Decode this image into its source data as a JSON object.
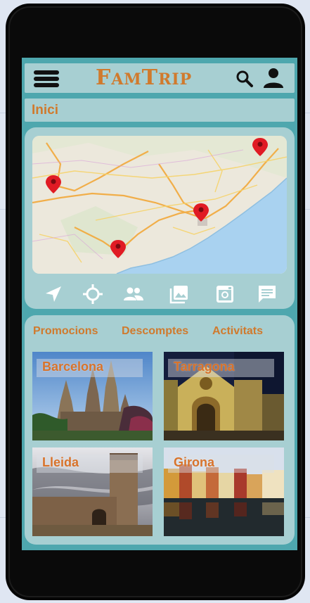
{
  "app": {
    "title_big_1": "F",
    "title_small_1": "AM",
    "title_big_2": "T",
    "title_small_2": "RIP"
  },
  "header": {
    "menu_icon": "hamburger-icon",
    "search_icon": "search-icon",
    "user_icon": "user-icon"
  },
  "breadcrumb": {
    "label": "Inici"
  },
  "toolbar": {
    "icons": [
      "navigation-arrow-icon",
      "crosshair-location-icon",
      "people-icon",
      "image-gallery-icon",
      "instagram-icon",
      "chat-message-icon"
    ]
  },
  "tabs": [
    {
      "label": "Promocions"
    },
    {
      "label": "Descomptes"
    },
    {
      "label": "Activitats"
    }
  ],
  "cities": [
    {
      "name": "Barcelona"
    },
    {
      "name": "Tarragona"
    },
    {
      "name": "Lleida"
    },
    {
      "name": "Girona"
    }
  ],
  "colors": {
    "accent": "#d07a2d",
    "panel": "#a7cfd2",
    "screen": "#4ea7ae",
    "pin": "#e01b24"
  }
}
